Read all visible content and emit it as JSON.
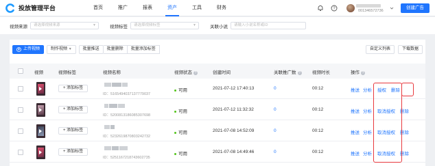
{
  "header": {
    "brand": "投放管理平台",
    "nav": [
      "首页",
      "推广",
      "报表",
      "资产",
      "工具",
      "财务"
    ],
    "active_nav": 3,
    "user_id": "001346572736",
    "create_button": "创建广告"
  },
  "filters": [
    {
      "label": "视频来源",
      "placeholder": "请选择视频来源"
    },
    {
      "label": "视频标签",
      "placeholder": "请选择视频标签"
    },
    {
      "label": "关联小说",
      "placeholder": "请输入小说名称或ID"
    }
  ],
  "toolbar": {
    "upload": "上传视频",
    "make_video": "制作视频",
    "batch_push": "批量推送",
    "batch_delete": "批量删除",
    "batch_add_tag": "批量添加标签",
    "custom_columns": "自定义列表",
    "download": "下载数据"
  },
  "table": {
    "headers": {
      "video": "视频",
      "tags": "视频标签",
      "name": "视频名称",
      "status": "视频状态",
      "created": "创建时间",
      "linked": "关联推广数",
      "duration": "视频时长",
      "ops": "操作"
    },
    "rows": [
      {
        "tag_btn": "+ 添加标签",
        "id": "ID：5165494037137779037",
        "status": "可用",
        "created": "2021-07-12 17:40:13",
        "count": "0",
        "duration": "00:12",
        "ops": [
          "推送",
          "分析",
          "授权",
          "删除"
        ]
      },
      {
        "tag_btn": "+ 添加标签",
        "id": "ID：5200813186085307698",
        "status": "可用",
        "created": "2021-07-12 11:32:32",
        "count": "0",
        "duration": "00:12",
        "ops": [
          "推送",
          "分析",
          "取消授权",
          "删除"
        ]
      },
      {
        "tag_btn": "+ 添加标签",
        "id": "ID：5232619870803242732",
        "status": "可用",
        "created": "2021-07-08 14:52:09",
        "count": "0",
        "duration": "00:12",
        "ops": [
          "推送",
          "分析",
          "取消授权",
          "删除"
        ]
      },
      {
        "tag_btn": "+ 添加标签",
        "id": "ID：5251167218743602735",
        "status": "可用",
        "created": "2021-07-08 14:49:46",
        "count": "0",
        "duration": "00:12",
        "ops": [
          "推送",
          "分析",
          "取消授权",
          "删除"
        ]
      }
    ]
  },
  "colors": {
    "accent": "#1f75fe",
    "highlight": "#e8383d",
    "status_ok": "#52c41a"
  }
}
